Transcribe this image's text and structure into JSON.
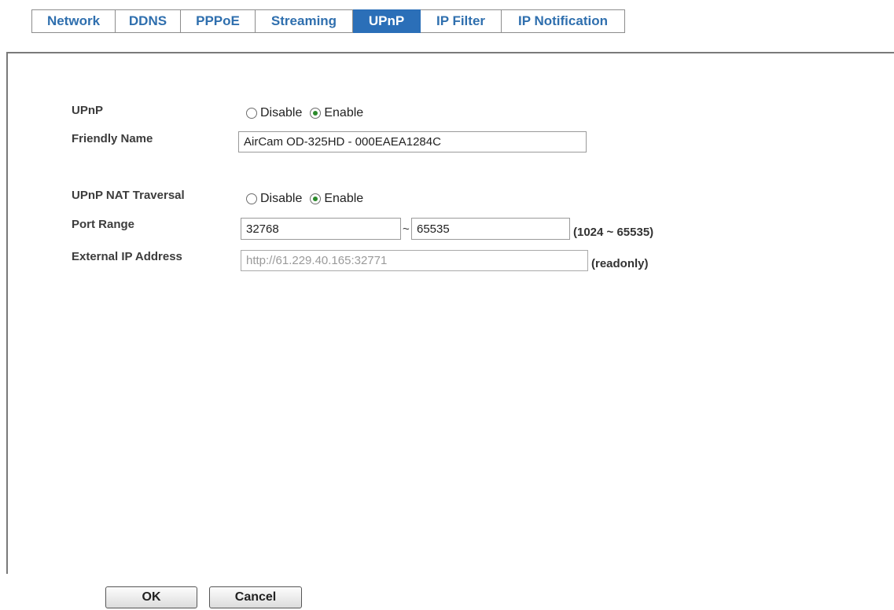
{
  "tabs": [
    {
      "label": "Network",
      "active": false
    },
    {
      "label": "DDNS",
      "active": false
    },
    {
      "label": "PPPoE",
      "active": false
    },
    {
      "label": "Streaming",
      "active": false
    },
    {
      "label": "UPnP",
      "active": true
    },
    {
      "label": "IP Filter",
      "active": false
    },
    {
      "label": "IP Notification",
      "active": false
    }
  ],
  "form": {
    "upnp": {
      "label": "UPnP",
      "options": [
        "Disable",
        "Enable"
      ],
      "selected": "Enable"
    },
    "friendly_name": {
      "label": "Friendly Name",
      "value": "AirCam OD-325HD - 000EAEA1284C"
    },
    "nat_traversal": {
      "label": "UPnP NAT Traversal",
      "options": [
        "Disable",
        "Enable"
      ],
      "selected": "Enable"
    },
    "port_range": {
      "label": "Port Range",
      "start": "32768",
      "separator": "~",
      "end": "65535",
      "hint": "(1024 ~ 65535)"
    },
    "external_ip": {
      "label": "External IP Address",
      "value": "http://61.229.40.165:32771",
      "hint": "(readonly)"
    }
  },
  "buttons": {
    "ok": "OK",
    "cancel": "Cancel"
  },
  "colors": {
    "tab_text": "#2f6fae",
    "tab_active_bg": "#2b6fb8",
    "radio_dot": "#2c8a2c"
  }
}
